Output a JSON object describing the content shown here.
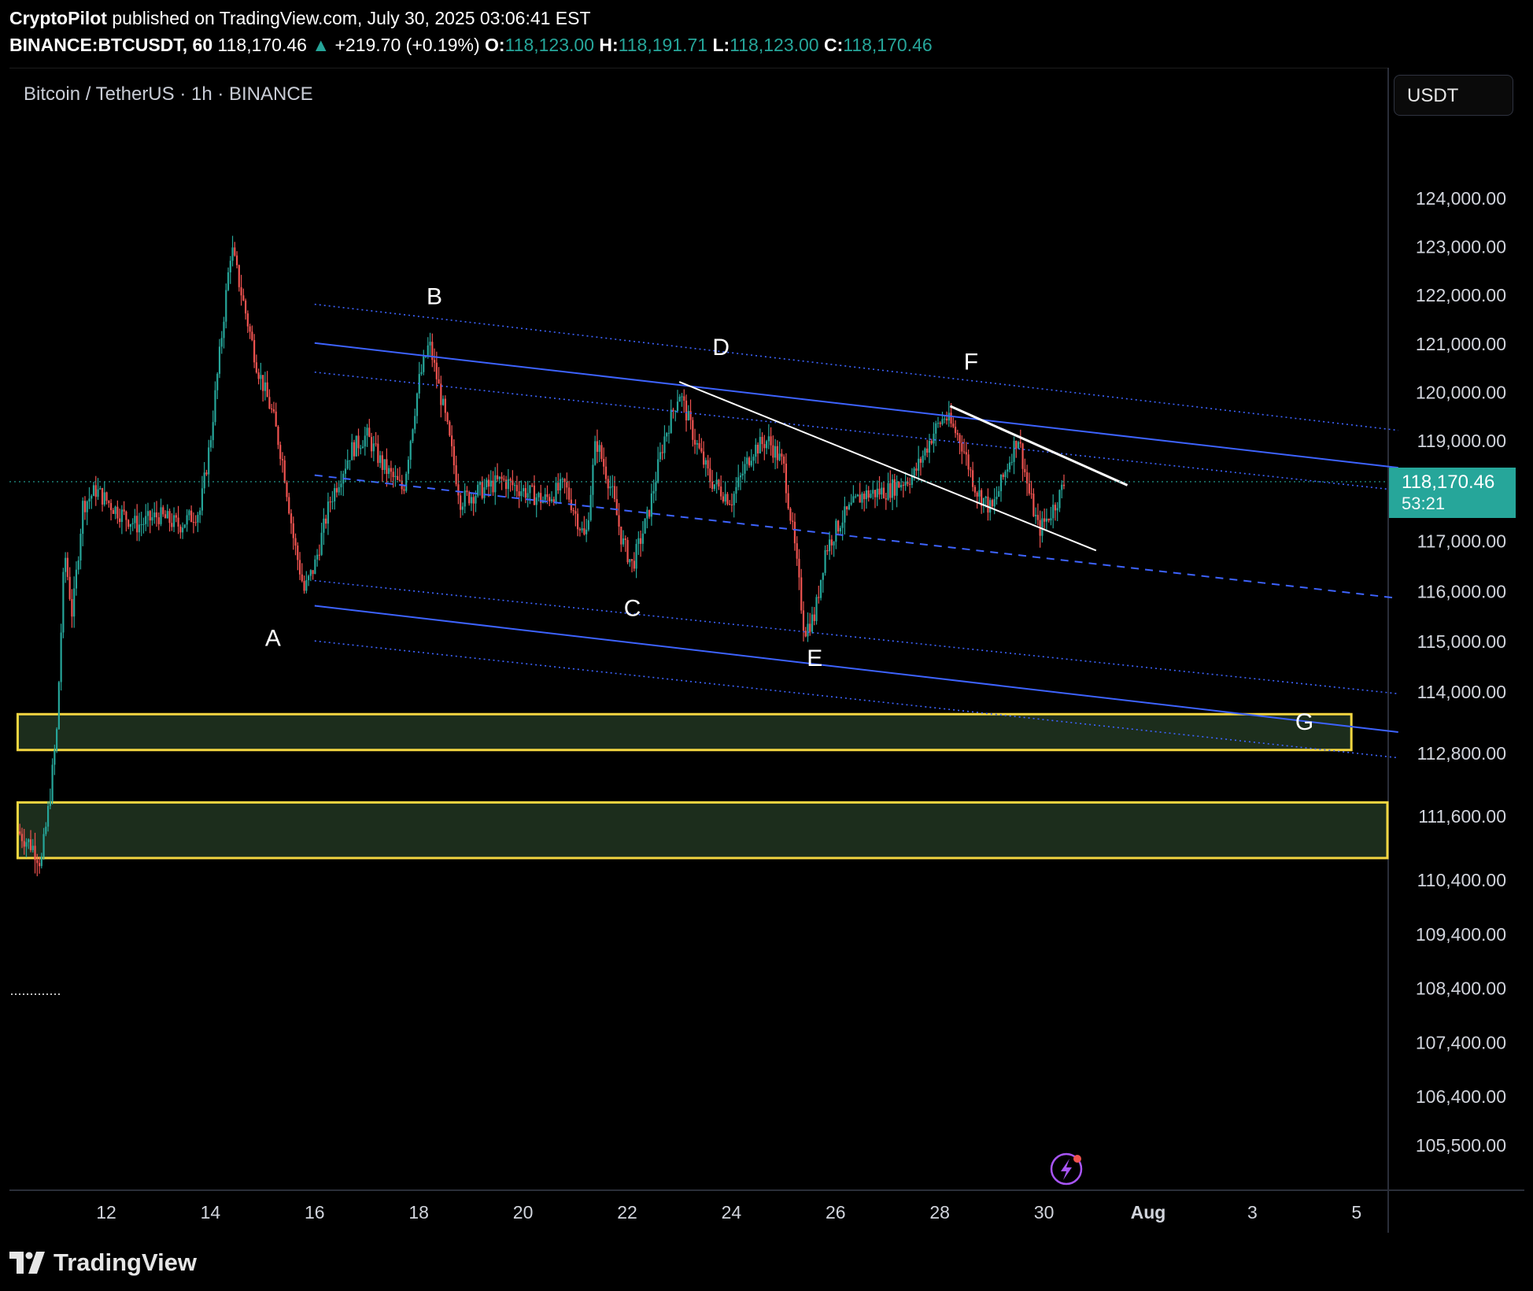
{
  "header": {
    "author": "CryptoPilot",
    "published_text": "published on TradingView.com, July 30, 2025 03:06:41 EST",
    "symbol_interval": "BINANCE:BTCUSDT, 60",
    "last_price": "118,170.46",
    "change_arrow": "▲",
    "change": "+219.70 (+0.19%)",
    "open_label": "O:",
    "open": "118,123.00",
    "high_label": "H:",
    "high": "118,191.71",
    "low_label": "L:",
    "low": "118,123.00",
    "close_label": "C:",
    "close": "118,170.46"
  },
  "chart_title": "Bitcoin / TetherUS · 1h · BINANCE",
  "currency": "USDT",
  "price_tag": {
    "price": "118,170.46",
    "countdown": "53:21"
  },
  "brand": "TradingView",
  "colors": {
    "up": "#26a69a",
    "down": "#ef5350",
    "channel": "#3d63ff",
    "zone_border": "#f3d641",
    "zone_fill": "#1c2d1c",
    "annotation": "#ffffff"
  },
  "chart_data": {
    "type": "candlestick",
    "title": "Bitcoin / TetherUS · 1h · BINANCE",
    "x_axis_labels": [
      "12",
      "14",
      "16",
      "18",
      "20",
      "22",
      "24",
      "26",
      "28",
      "30",
      "Aug",
      "3",
      "5"
    ],
    "y_axis_labels": [
      "124,000.00",
      "123,000.00",
      "122,000.00",
      "121,000.00",
      "120,000.00",
      "119,000.00",
      "117,000.00",
      "116,000.00",
      "115,000.00",
      "114,000.00",
      "112,800.00",
      "111,600.00",
      "110,400.00",
      "109,400.00",
      "108,400.00",
      "107,400.00",
      "106,400.00",
      "105,500.00"
    ],
    "y_axis_range": [
      105000,
      125500
    ],
    "x_axis_range_days_of_july": [
      10.3,
      36.8
    ],
    "price_path": [
      {
        "day": 10.3,
        "price": 111300
      },
      {
        "day": 10.6,
        "price": 111000
      },
      {
        "day": 10.75,
        "price": 110700
      },
      {
        "day": 10.9,
        "price": 111800
      },
      {
        "day": 11.05,
        "price": 113200
      },
      {
        "day": 11.2,
        "price": 116800
      },
      {
        "day": 11.35,
        "price": 115500
      },
      {
        "day": 11.55,
        "price": 117700
      },
      {
        "day": 11.8,
        "price": 118000
      },
      {
        "day": 12.2,
        "price": 117600
      },
      {
        "day": 12.6,
        "price": 117300
      },
      {
        "day": 13.0,
        "price": 117500
      },
      {
        "day": 13.4,
        "price": 117300
      },
      {
        "day": 13.8,
        "price": 117600
      },
      {
        "day": 14.0,
        "price": 119000
      },
      {
        "day": 14.2,
        "price": 121000
      },
      {
        "day": 14.4,
        "price": 123000
      },
      {
        "day": 14.6,
        "price": 122000
      },
      {
        "day": 14.9,
        "price": 120500
      },
      {
        "day": 15.2,
        "price": 119500
      },
      {
        "day": 15.4,
        "price": 118500
      },
      {
        "day": 15.6,
        "price": 117000
      },
      {
        "day": 15.8,
        "price": 116000
      },
      {
        "day": 16.0,
        "price": 116500
      },
      {
        "day": 16.3,
        "price": 117800
      },
      {
        "day": 16.7,
        "price": 118800
      },
      {
        "day": 17.0,
        "price": 119100
      },
      {
        "day": 17.3,
        "price": 118500
      },
      {
        "day": 17.7,
        "price": 118000
      },
      {
        "day": 18.0,
        "price": 120200
      },
      {
        "day": 18.2,
        "price": 121000
      },
      {
        "day": 18.5,
        "price": 119500
      },
      {
        "day": 18.8,
        "price": 117800
      },
      {
        "day": 19.2,
        "price": 118000
      },
      {
        "day": 19.6,
        "price": 118200
      },
      {
        "day": 20.0,
        "price": 118000
      },
      {
        "day": 20.4,
        "price": 117800
      },
      {
        "day": 20.8,
        "price": 118100
      },
      {
        "day": 21.2,
        "price": 117000
      },
      {
        "day": 21.4,
        "price": 119000
      },
      {
        "day": 21.7,
        "price": 118000
      },
      {
        "day": 21.9,
        "price": 117000
      },
      {
        "day": 22.1,
        "price": 116500
      },
      {
        "day": 22.4,
        "price": 117500
      },
      {
        "day": 22.7,
        "price": 119000
      },
      {
        "day": 23.0,
        "price": 120000
      },
      {
        "day": 23.3,
        "price": 119000
      },
      {
        "day": 23.6,
        "price": 118200
      },
      {
        "day": 24.0,
        "price": 117800
      },
      {
        "day": 24.4,
        "price": 118800
      },
      {
        "day": 24.7,
        "price": 119000
      },
      {
        "day": 25.0,
        "price": 118500
      },
      {
        "day": 25.2,
        "price": 117000
      },
      {
        "day": 25.4,
        "price": 115200
      },
      {
        "day": 25.6,
        "price": 115500
      },
      {
        "day": 25.8,
        "price": 116800
      },
      {
        "day": 26.1,
        "price": 117400
      },
      {
        "day": 26.5,
        "price": 117900
      },
      {
        "day": 27.0,
        "price": 118000
      },
      {
        "day": 27.5,
        "price": 118300
      },
      {
        "day": 27.9,
        "price": 119200
      },
      {
        "day": 28.1,
        "price": 119500
      },
      {
        "day": 28.4,
        "price": 119000
      },
      {
        "day": 28.7,
        "price": 118000
      },
      {
        "day": 29.0,
        "price": 117600
      },
      {
        "day": 29.3,
        "price": 118500
      },
      {
        "day": 29.5,
        "price": 119100
      },
      {
        "day": 29.7,
        "price": 118000
      },
      {
        "day": 29.9,
        "price": 117200
      },
      {
        "day": 30.1,
        "price": 117500
      },
      {
        "day": 30.3,
        "price": 117900
      },
      {
        "day": 30.4,
        "price": 118170
      }
    ],
    "channel": {
      "main_upper": [
        [
          16.0,
          121000
        ],
        [
          36.8,
          118450
        ]
      ],
      "main_lower": [
        [
          16.0,
          115700
        ],
        [
          36.8,
          113200
        ]
      ],
      "midline": [
        [
          16.0,
          118300
        ],
        [
          36.8,
          115850
        ]
      ],
      "inner_dotted": [
        [
          [
            16.0,
            120400
          ],
          [
            36.8,
            118000
          ]
        ],
        [
          [
            16.0,
            116200
          ],
          [
            36.8,
            113950
          ]
        ]
      ],
      "outer_dotted": [
        [
          [
            16.0,
            121800
          ],
          [
            36.8,
            119200
          ]
        ],
        [
          [
            16.0,
            115000
          ],
          [
            36.8,
            112700
          ]
        ]
      ]
    },
    "trendlines": [
      [
        [
          23.0,
          120200
        ],
        [
          31.0,
          116800
        ]
      ],
      [
        [
          28.2,
          119700
        ],
        [
          31.6,
          118100
        ]
      ]
    ],
    "zones": [
      {
        "from_day": 10.3,
        "to_day": 35.9,
        "low": 112850,
        "high": 113550
      },
      {
        "from_day": 10.3,
        "to_day": 36.8,
        "low": 110800,
        "high": 111850
      }
    ],
    "wave_labels": [
      {
        "text": "A",
        "day": 15.2,
        "price": 114900
      },
      {
        "text": "B",
        "day": 18.3,
        "price": 121800
      },
      {
        "text": "C",
        "day": 22.1,
        "price": 115500
      },
      {
        "text": "D",
        "day": 23.8,
        "price": 120750
      },
      {
        "text": "E",
        "day": 25.6,
        "price": 114500
      },
      {
        "text": "F",
        "day": 28.6,
        "price": 120450
      },
      {
        "text": "G",
        "day": 35.0,
        "price": 113250
      }
    ],
    "current_price": 118170.46
  }
}
